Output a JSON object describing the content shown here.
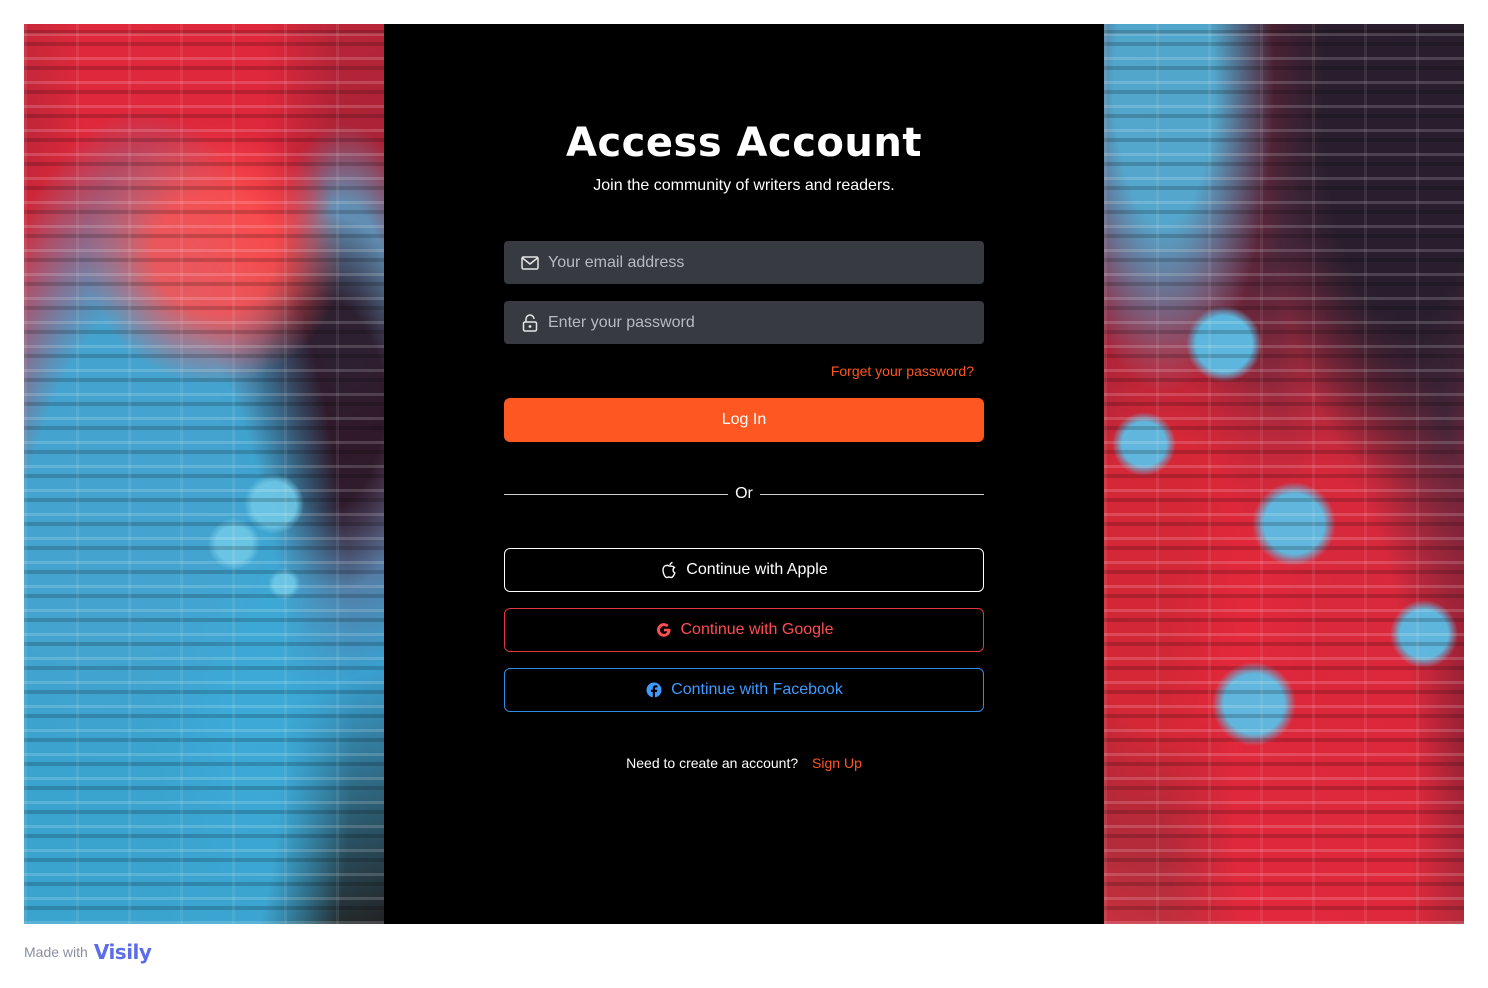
{
  "login": {
    "title": "Access Account",
    "subtitle": "Join the community of writers and readers.",
    "email_placeholder": "Your email address",
    "password_placeholder": "Enter your password",
    "forgot_label": "Forget your password?",
    "login_label": "Log In",
    "divider_label": "Or",
    "apple_label": "Continue with Apple",
    "google_label": "Continue with Google",
    "facebook_label": "Continue with Facebook",
    "signup_question": "Need to create an account?",
    "signup_label": "Sign Up"
  },
  "icons": {
    "email": "mail-icon",
    "password": "lock-icon",
    "apple": "apple-icon",
    "google": "google-icon",
    "facebook": "facebook-icon"
  },
  "colors": {
    "accent": "#ff5722",
    "panel_bg": "#000000",
    "field_bg": "#373a41",
    "google": "#ff4d52",
    "facebook": "#3f9bff"
  },
  "footer": {
    "made_with": "Made with",
    "brand": "Visily"
  }
}
